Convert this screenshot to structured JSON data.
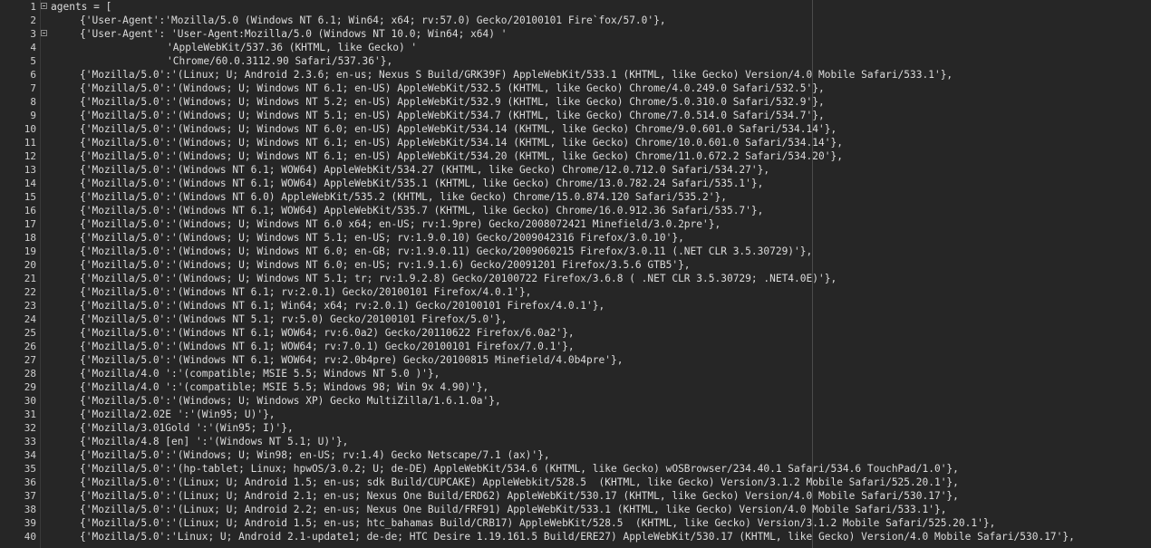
{
  "lines": [
    {
      "n": "1",
      "text": "agents = [",
      "fold": true,
      "indent": 0
    },
    {
      "n": "2",
      "text": "{'User-Agent':'Mozilla/5.0 (Windows NT 6.1; Win64; x64; rv:57.0) Gecko/20100101 Fire`fox/57.0'},",
      "fold": false,
      "indent": 1
    },
    {
      "n": "3",
      "text": "{'User-Agent': 'User-Agent:Mozilla/5.0 (Windows NT 10.0; Win64; x64) '",
      "fold": true,
      "indent": 1
    },
    {
      "n": "4",
      "text": "'AppleWebKit/537.36 (KHTML, like Gecko) '",
      "fold": false,
      "indent": 2
    },
    {
      "n": "5",
      "text": "'Chrome/60.0.3112.90 Safari/537.36'},",
      "fold": false,
      "indent": 2
    },
    {
      "n": "6",
      "text": "{'Mozilla/5.0':'(Linux; U; Android 2.3.6; en-us; Nexus S Build/GRK39F) AppleWebKit/533.1 (KHTML, like Gecko) Version/4.0 Mobile Safari/533.1'},",
      "fold": false,
      "indent": 1
    },
    {
      "n": "7",
      "text": "{'Mozilla/5.0':'(Windows; U; Windows NT 6.1; en-US) AppleWebKit/532.5 (KHTML, like Gecko) Chrome/4.0.249.0 Safari/532.5'},",
      "fold": false,
      "indent": 1
    },
    {
      "n": "8",
      "text": "{'Mozilla/5.0':'(Windows; U; Windows NT 5.2; en-US) AppleWebKit/532.9 (KHTML, like Gecko) Chrome/5.0.310.0 Safari/532.9'},",
      "fold": false,
      "indent": 1
    },
    {
      "n": "9",
      "text": "{'Mozilla/5.0':'(Windows; U; Windows NT 5.1; en-US) AppleWebKit/534.7 (KHTML, like Gecko) Chrome/7.0.514.0 Safari/534.7'},",
      "fold": false,
      "indent": 1
    },
    {
      "n": "10",
      "text": "{'Mozilla/5.0':'(Windows; U; Windows NT 6.0; en-US) AppleWebKit/534.14 (KHTML, like Gecko) Chrome/9.0.601.0 Safari/534.14'},",
      "fold": false,
      "indent": 1
    },
    {
      "n": "11",
      "text": "{'Mozilla/5.0':'(Windows; U; Windows NT 6.1; en-US) AppleWebKit/534.14 (KHTML, like Gecko) Chrome/10.0.601.0 Safari/534.14'},",
      "fold": false,
      "indent": 1
    },
    {
      "n": "12",
      "text": "{'Mozilla/5.0':'(Windows; U; Windows NT 6.1; en-US) AppleWebKit/534.20 (KHTML, like Gecko) Chrome/11.0.672.2 Safari/534.20'},",
      "fold": false,
      "indent": 1
    },
    {
      "n": "13",
      "text": "{'Mozilla/5.0':'(Windows NT 6.1; WOW64) AppleWebKit/534.27 (KHTML, like Gecko) Chrome/12.0.712.0 Safari/534.27'},",
      "fold": false,
      "indent": 1
    },
    {
      "n": "14",
      "text": "{'Mozilla/5.0':'(Windows NT 6.1; WOW64) AppleWebKit/535.1 (KHTML, like Gecko) Chrome/13.0.782.24 Safari/535.1'},",
      "fold": false,
      "indent": 1
    },
    {
      "n": "15",
      "text": "{'Mozilla/5.0':'(Windows NT 6.0) AppleWebKit/535.2 (KHTML, like Gecko) Chrome/15.0.874.120 Safari/535.2'},",
      "fold": false,
      "indent": 1
    },
    {
      "n": "16",
      "text": "{'Mozilla/5.0':'(Windows NT 6.1; WOW64) AppleWebKit/535.7 (KHTML, like Gecko) Chrome/16.0.912.36 Safari/535.7'},",
      "fold": false,
      "indent": 1
    },
    {
      "n": "17",
      "text": "{'Mozilla/5.0':'(Windows; U; Windows NT 6.0 x64; en-US; rv:1.9pre) Gecko/2008072421 Minefield/3.0.2pre'},",
      "fold": false,
      "indent": 1
    },
    {
      "n": "18",
      "text": "{'Mozilla/5.0':'(Windows; U; Windows NT 5.1; en-US; rv:1.9.0.10) Gecko/2009042316 Firefox/3.0.10'},",
      "fold": false,
      "indent": 1
    },
    {
      "n": "19",
      "text": "{'Mozilla/5.0':'(Windows; U; Windows NT 6.0; en-GB; rv:1.9.0.11) Gecko/2009060215 Firefox/3.0.11 (.NET CLR 3.5.30729)'},",
      "fold": false,
      "indent": 1
    },
    {
      "n": "20",
      "text": "{'Mozilla/5.0':'(Windows; U; Windows NT 6.0; en-US; rv:1.9.1.6) Gecko/20091201 Firefox/3.5.6 GTB5'},",
      "fold": false,
      "indent": 1
    },
    {
      "n": "21",
      "text": "{'Mozilla/5.0':'(Windows; U; Windows NT 5.1; tr; rv:1.9.2.8) Gecko/20100722 Firefox/3.6.8 ( .NET CLR 3.5.30729; .NET4.0E)'},",
      "fold": false,
      "indent": 1
    },
    {
      "n": "22",
      "text": "{'Mozilla/5.0':'(Windows NT 6.1; rv:2.0.1) Gecko/20100101 Firefox/4.0.1'},",
      "fold": false,
      "indent": 1
    },
    {
      "n": "23",
      "text": "{'Mozilla/5.0':'(Windows NT 6.1; Win64; x64; rv:2.0.1) Gecko/20100101 Firefox/4.0.1'},",
      "fold": false,
      "indent": 1
    },
    {
      "n": "24",
      "text": "{'Mozilla/5.0':'(Windows NT 5.1; rv:5.0) Gecko/20100101 Firefox/5.0'},",
      "fold": false,
      "indent": 1
    },
    {
      "n": "25",
      "text": "{'Mozilla/5.0':'(Windows NT 6.1; WOW64; rv:6.0a2) Gecko/20110622 Firefox/6.0a2'},",
      "fold": false,
      "indent": 1
    },
    {
      "n": "26",
      "text": "{'Mozilla/5.0':'(Windows NT 6.1; WOW64; rv:7.0.1) Gecko/20100101 Firefox/7.0.1'},",
      "fold": false,
      "indent": 1
    },
    {
      "n": "27",
      "text": "{'Mozilla/5.0':'(Windows NT 6.1; WOW64; rv:2.0b4pre) Gecko/20100815 Minefield/4.0b4pre'},",
      "fold": false,
      "indent": 1
    },
    {
      "n": "28",
      "text": "{'Mozilla/4.0 ':'(compatible; MSIE 5.5; Windows NT 5.0 )'},",
      "fold": false,
      "indent": 1
    },
    {
      "n": "29",
      "text": "{'Mozilla/4.0 ':'(compatible; MSIE 5.5; Windows 98; Win 9x 4.90)'},",
      "fold": false,
      "indent": 1
    },
    {
      "n": "30",
      "text": "{'Mozilla/5.0':'(Windows; U; Windows XP) Gecko MultiZilla/1.6.1.0a'},",
      "fold": false,
      "indent": 1
    },
    {
      "n": "31",
      "text": "{'Mozilla/2.02E ':'(Win95; U)'},",
      "fold": false,
      "indent": 1
    },
    {
      "n": "32",
      "text": "{'Mozilla/3.01Gold ':'(Win95; I)'},",
      "fold": false,
      "indent": 1
    },
    {
      "n": "33",
      "text": "{'Mozilla/4.8 [en] ':'(Windows NT 5.1; U)'},",
      "fold": false,
      "indent": 1
    },
    {
      "n": "34",
      "text": "{'Mozilla/5.0':'(Windows; U; Win98; en-US; rv:1.4) Gecko Netscape/7.1 (ax)'},",
      "fold": false,
      "indent": 1
    },
    {
      "n": "35",
      "text": "{'Mozilla/5.0':'(hp-tablet; Linux; hpwOS/3.0.2; U; de-DE) AppleWebKit/534.6 (KHTML, like Gecko) wOSBrowser/234.40.1 Safari/534.6 TouchPad/1.0'},",
      "fold": false,
      "indent": 1
    },
    {
      "n": "36",
      "text": "{'Mozilla/5.0':'(Linux; U; Android 1.5; en-us; sdk Build/CUPCAKE) AppleWebkit/528.5  (KHTML, like Gecko) Version/3.1.2 Mobile Safari/525.20.1'},",
      "fold": false,
      "indent": 1
    },
    {
      "n": "37",
      "text": "{'Mozilla/5.0':'(Linux; U; Android 2.1; en-us; Nexus One Build/ERD62) AppleWebKit/530.17 (KHTML, like Gecko) Version/4.0 Mobile Safari/530.17'},",
      "fold": false,
      "indent": 1
    },
    {
      "n": "38",
      "text": "{'Mozilla/5.0':'(Linux; U; Android 2.2; en-us; Nexus One Build/FRF91) AppleWebKit/533.1 (KHTML, like Gecko) Version/4.0 Mobile Safari/533.1'},",
      "fold": false,
      "indent": 1
    },
    {
      "n": "39",
      "text": "{'Mozilla/5.0':'(Linux; U; Android 1.5; en-us; htc_bahamas Build/CRB17) AppleWebKit/528.5  (KHTML, like Gecko) Version/3.1.2 Mobile Safari/525.20.1'},",
      "fold": false,
      "indent": 1
    },
    {
      "n": "40",
      "text": "{'Mozilla/5.0':'Linux; U; Android 2.1-update1; de-de; HTC Desire 1.19.161.5 Build/ERE27) AppleWebKit/530.17 (KHTML, like Gecko) Version/4.0 Mobile Safari/530.17'},",
      "fold": false,
      "indent": 1
    }
  ]
}
